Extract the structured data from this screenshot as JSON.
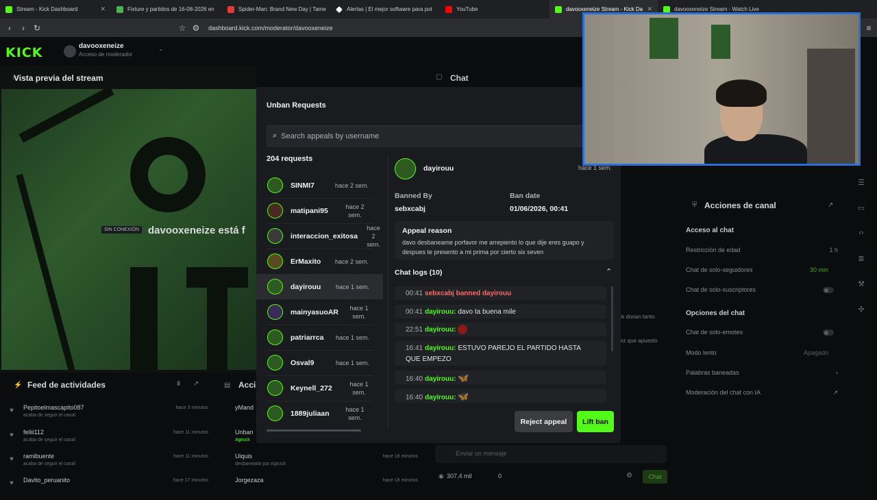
{
  "browser": {
    "tabs": [
      {
        "title": "Stream - Kick Dashboard",
        "color": "#53fc18"
      },
      {
        "title": "Fixture y partidos de 16-08-2026 en",
        "color": "#4caf50"
      },
      {
        "title": "Spider-Man: Brand New Day | Tame",
        "color": "#e53935"
      },
      {
        "title": "Alertas | El mejor software para pot",
        "color": "#ffffff"
      },
      {
        "title": "YouTube",
        "color": "#ff0000"
      },
      {
        "title": "davooxeneize Stream - Kick Da",
        "color": "#53fc18"
      },
      {
        "title": "davooxeneize Stream - Watch Live",
        "color": "#53fc18"
      }
    ],
    "url": "dashboard.kick.com/moderator/davooxeneize"
  },
  "header": {
    "logo": "KICK",
    "channel": "davooxeneize",
    "role": "Acceso de moderador"
  },
  "preview": {
    "title": "Vista previa del stream",
    "offline_badge": "SIN CONEXIÓN",
    "offline_message": "davooxeneize está f"
  },
  "feed": {
    "title": "Feed de actividades",
    "items": [
      {
        "name": "Pepitoelmascapito087",
        "sub": "acaba de seguir el canal",
        "time": "hace 3 minutos"
      },
      {
        "name": "feliii112",
        "sub": "acaba de seguir el canal",
        "time": "hace 11 minutos"
      },
      {
        "name": "ramibuente",
        "sub": "acaba de seguir el canal",
        "time": "hace 11 minutos"
      },
      {
        "name": "Davito_peruanito",
        "sub": "",
        "time": "hace 17 minutos"
      }
    ]
  },
  "modlog": {
    "title": "Acci",
    "items": [
      {
        "name": "yMand",
        "sub": "",
        "time": ""
      },
      {
        "name": "Unban",
        "sub": "Agruck",
        "time": ""
      },
      {
        "name": "Uiquis",
        "sub": "desbaneado por Agruck",
        "time": "hace 18 minutos"
      },
      {
        "name": "Jorgezaza",
        "sub": "",
        "time": "hace 18 minutos"
      }
    ]
  },
  "chat": {
    "title": "Chat",
    "input_placeholder": "Enviar un mensaje",
    "viewers": "307,4 mil",
    "count": "0",
    "send_label": "Chat",
    "partial_line1": "le donan tanto",
    "partial_line2": "ez que apuesto"
  },
  "actions": {
    "title": "Acciones de canal",
    "access_section": "Acceso al chat",
    "access_rows": [
      {
        "label": "Restricción de edad",
        "value": "1 h"
      },
      {
        "label": "Chat de solo-seguidores",
        "value": "30 min"
      },
      {
        "label": "Chat de solo-suscriptores",
        "value": ""
      }
    ],
    "options_section": "Opciones del chat",
    "option_rows": [
      {
        "label": "Chat de solo-emotes",
        "value": ""
      },
      {
        "label": "Modo lento",
        "value": "Apagado"
      },
      {
        "label": "Palabras baneadas",
        "value": ""
      },
      {
        "label": "Moderación del chat con IA",
        "value": ""
      }
    ],
    "accent_color": "#53fc18"
  },
  "modal": {
    "title": "Unban Requests",
    "search_placeholder": "Search appeals by username",
    "count_label": "204 requests",
    "requests": [
      {
        "username": "SINMI7",
        "time": "hace 2 sem."
      },
      {
        "username": "matipani95",
        "time": "hace 2 sem."
      },
      {
        "username": "interaccion_exitosa",
        "time": "hace 2 sem."
      },
      {
        "username": "ErMaxito",
        "time": "hace 2 sem."
      },
      {
        "username": "dayirouu",
        "time": "hace 1 sem."
      },
      {
        "username": "mainyasuoAR",
        "time": "hace 1 sem."
      },
      {
        "username": "patriarrca",
        "time": "hace 1 sem."
      },
      {
        "username": "Osval9",
        "time": "hace 1 sem."
      },
      {
        "username": "Keynell_272",
        "time": "hace 1 sem."
      },
      {
        "username": "1889juliaan",
        "time": "hace 1 sem."
      }
    ],
    "selected": {
      "username": "dayirouu",
      "time": "hace 1 sem.",
      "banned_by_label": "Banned By",
      "banned_by": "sebxcabj",
      "ban_date_label": "Ban date",
      "ban_date": "01/06/2026, 00:41",
      "reason_title": "Appeal reason",
      "reason": "davo desbaneame porfavor me arrepiento lo que dije eres guapo y despues te presento a mi prima por cierto six seven",
      "logs_title": "Chat logs (10)",
      "logs": [
        {
          "time": "00:41",
          "user": "sebxcabj banned dayirouu",
          "text": "",
          "type": "ban"
        },
        {
          "time": "00:41",
          "user": "dayirouu:",
          "text": "davo ta buena mile",
          "type": "msg"
        },
        {
          "time": "22:51",
          "user": "dayirouu:",
          "text": "",
          "type": "emote",
          "emote": "red-emote"
        },
        {
          "time": "16:41",
          "user": "dayirouu:",
          "text": "ESTUVO PAREJO EL PARTIDO HASTA QUE EMPEZO",
          "type": "msg"
        },
        {
          "time": "16:40",
          "user": "dayirouu:",
          "text": "",
          "type": "emote",
          "emote": "butterfly-emote"
        },
        {
          "time": "16:40",
          "user": "dayirouu:",
          "text": "",
          "type": "emote",
          "emote": "butterfly-emote"
        }
      ]
    },
    "reject_label": "Reject appeal",
    "lift_label": "Lift ban"
  }
}
